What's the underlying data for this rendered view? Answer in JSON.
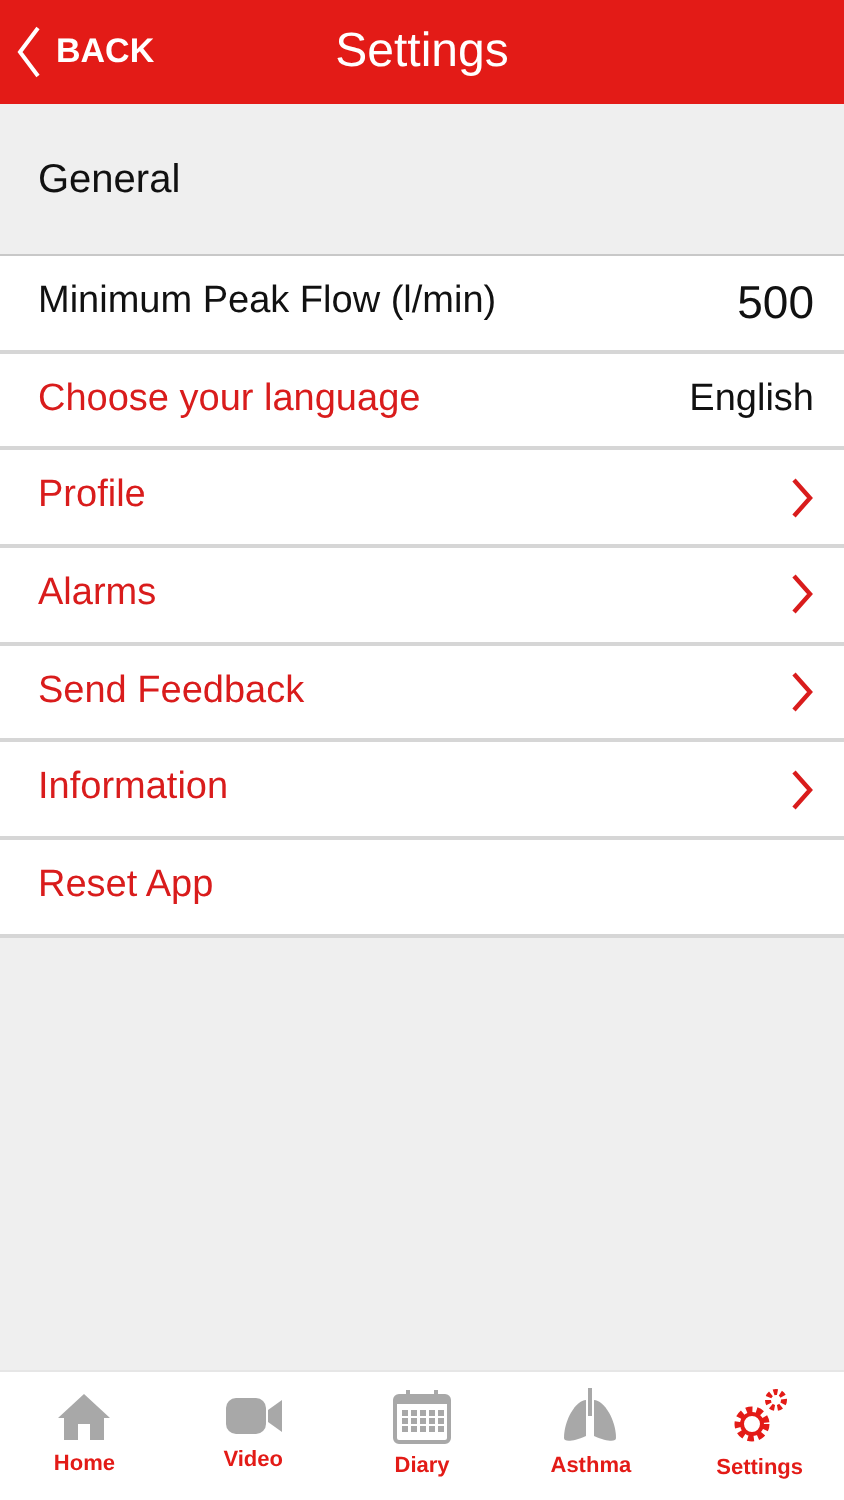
{
  "header": {
    "back": "BACK",
    "title": "Settings"
  },
  "section": "General",
  "rows": [
    {
      "kind": "value",
      "label": "Minimum Peak Flow (l/min)",
      "value": "500"
    },
    {
      "kind": "choice",
      "label": "Choose your language",
      "value": "English"
    },
    {
      "kind": "link",
      "label": "Profile"
    },
    {
      "kind": "link",
      "label": "Alarms"
    },
    {
      "kind": "link",
      "label": "Send Feedback"
    },
    {
      "kind": "link",
      "label": "Information"
    },
    {
      "kind": "action",
      "label": "Reset App"
    }
  ],
  "tabs": [
    {
      "kind": "home",
      "label": "Home",
      "selected": false
    },
    {
      "kind": "video",
      "label": "Video",
      "selected": false
    },
    {
      "kind": "diary",
      "label": "Diary",
      "selected": false
    },
    {
      "kind": "asthma",
      "label": "Asthma",
      "selected": false
    },
    {
      "kind": "settings",
      "label": "Settings",
      "selected": true
    }
  ]
}
